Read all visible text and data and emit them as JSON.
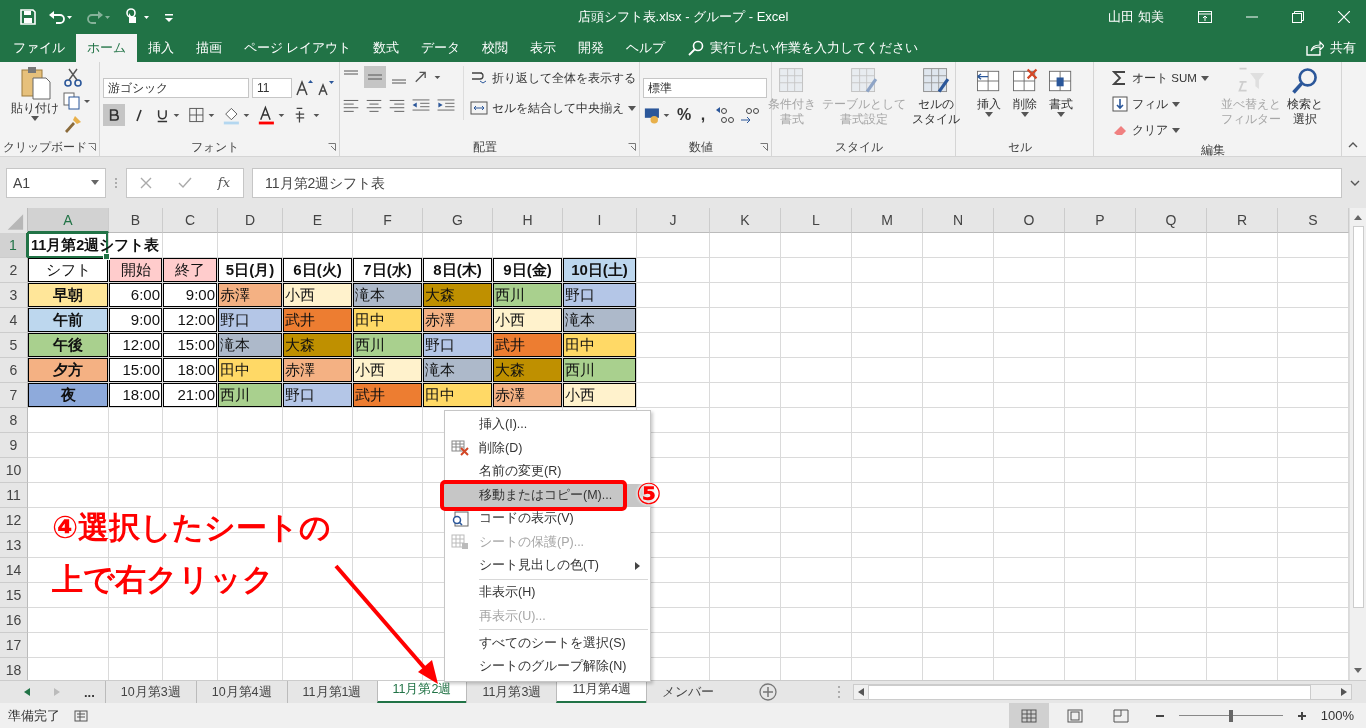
{
  "title_bar": {
    "title": "店頭シフト表.xlsx  -  グループ  -  Excel",
    "user": "山田 知美"
  },
  "ribbon": {
    "tabs": [
      {
        "label": "ファイル",
        "selected": false
      },
      {
        "label": "ホーム",
        "selected": true
      },
      {
        "label": "挿入",
        "selected": false
      },
      {
        "label": "描画",
        "selected": false
      },
      {
        "label": "ページ レイアウト",
        "selected": false
      },
      {
        "label": "数式",
        "selected": false
      },
      {
        "label": "データ",
        "selected": false
      },
      {
        "label": "校閲",
        "selected": false
      },
      {
        "label": "表示",
        "selected": false
      },
      {
        "label": "開発",
        "selected": false
      },
      {
        "label": "ヘルプ",
        "selected": false
      }
    ],
    "tell_me": "実行したい作業を入力してください",
    "share": "共有",
    "groups": [
      {
        "label": "クリップボード",
        "paste": "貼り付け"
      },
      {
        "label": "フォント",
        "font_name": "游ゴシック",
        "font_size": "11",
        "bold": true
      },
      {
        "label": "配置",
        "middle_align": true,
        "wrap_text": "折り返して全体を表示する",
        "merge": "セルを結合して中央揃え"
      },
      {
        "label": "数値",
        "format": "標準",
        "percent": "%",
        "comma": ","
      },
      {
        "label": "スタイル",
        "buttons": [
          {
            "lines": [
              "条件付き",
              "書式"
            ],
            "disabled": true
          },
          {
            "lines": [
              "テーブルとして",
              "書式設定"
            ],
            "disabled": true
          },
          {
            "lines": [
              "セルの",
              "スタイル"
            ],
            "disabled": false
          }
        ]
      },
      {
        "label": "セル",
        "buttons": [
          {
            "lines": [
              "挿入"
            ],
            "disabled": false
          },
          {
            "lines": [
              "削除"
            ],
            "disabled": false
          },
          {
            "lines": [
              "書式"
            ],
            "disabled": false
          }
        ]
      },
      {
        "label": "編集",
        "small": [
          "オート SUM",
          "フィル",
          "クリア"
        ],
        "buttons": [
          {
            "lines": [
              "並べ替えと",
              "フィルター"
            ],
            "disabled": true
          },
          {
            "lines": [
              "検索と",
              "選択"
            ],
            "disabled": false
          }
        ]
      }
    ]
  },
  "formula_bar": {
    "name_box": "A1",
    "function_label": "fx",
    "formula": "11月第2週シフト表"
  },
  "sheet": {
    "columns": [
      {
        "label": "A",
        "selected": true
      },
      {
        "label": "B",
        "selected": false
      },
      {
        "label": "C",
        "selected": false
      },
      {
        "label": "D",
        "selected": false
      },
      {
        "label": "E",
        "selected": false
      },
      {
        "label": "F",
        "selected": false
      },
      {
        "label": "G",
        "selected": false
      },
      {
        "label": "H",
        "selected": false
      },
      {
        "label": "I",
        "selected": false
      },
      {
        "label": "J",
        "selected": false
      },
      {
        "label": "K",
        "selected": false
      },
      {
        "label": "L",
        "selected": false
      },
      {
        "label": "M",
        "selected": false
      },
      {
        "label": "N",
        "selected": false
      },
      {
        "label": "O",
        "selected": false
      },
      {
        "label": "P",
        "selected": false
      },
      {
        "label": "Q",
        "selected": false
      },
      {
        "label": "R",
        "selected": false
      },
      {
        "label": "S",
        "selected": false
      }
    ],
    "rows": [
      {
        "label": "1",
        "selected": true,
        "cells": [
          {
            "text": "11月第2週シフト表",
            "kind": "title",
            "bold": true,
            "selected": true
          }
        ]
      },
      {
        "label": "2",
        "selected": false,
        "cells": [
          {
            "text": "シフト",
            "kind": "label",
            "bold": false
          },
          {
            "text": "開始",
            "kind": "label",
            "bold": false,
            "color": "#ffcccc"
          },
          {
            "text": "終了",
            "kind": "label",
            "bold": false,
            "color": "#ffcccc"
          },
          {
            "text": "5日(月)",
            "kind": "label",
            "bold": true
          },
          {
            "text": "6日(火)",
            "kind": "label",
            "bold": true
          },
          {
            "text": "7日(水)",
            "kind": "label",
            "bold": true
          },
          {
            "text": "8日(木)",
            "kind": "label",
            "bold": true
          },
          {
            "text": "9日(金)",
            "kind": "label",
            "bold": true
          },
          {
            "text": "10日(土)",
            "kind": "label",
            "bold": true,
            "color": "#bdd7ee"
          }
        ]
      },
      {
        "label": "3",
        "selected": false,
        "cells": [
          {
            "text": "早朝",
            "kind": "label",
            "bold": true,
            "color": "#ffe699"
          },
          {
            "text": "6:00",
            "kind": "time",
            "bold": false
          },
          {
            "text": "9:00",
            "kind": "time",
            "bold": false
          },
          {
            "text": "赤澤",
            "kind": "name",
            "bold": false,
            "color": "#f4b183"
          },
          {
            "text": "小西",
            "kind": "name",
            "bold": false,
            "color": "#fff2cc"
          },
          {
            "text": "滝本",
            "kind": "name",
            "bold": false,
            "color": "#adb9ca"
          },
          {
            "text": "大森",
            "kind": "name",
            "bold": false,
            "color": "#bf9000"
          },
          {
            "text": "西川",
            "kind": "name",
            "bold": false,
            "color": "#a9d08e"
          },
          {
            "text": "野口",
            "kind": "name",
            "bold": false,
            "color": "#b4c6e7"
          }
        ]
      },
      {
        "label": "4",
        "selected": false,
        "cells": [
          {
            "text": "午前",
            "kind": "label",
            "bold": true,
            "color": "#bdd7ee"
          },
          {
            "text": "9:00",
            "kind": "time",
            "bold": false
          },
          {
            "text": "12:00",
            "kind": "time",
            "bold": false
          },
          {
            "text": "野口",
            "kind": "name",
            "bold": false,
            "color": "#b4c6e7"
          },
          {
            "text": "武井",
            "kind": "name",
            "bold": false,
            "color": "#ed7d31"
          },
          {
            "text": "田中",
            "kind": "name",
            "bold": false,
            "color": "#ffd966"
          },
          {
            "text": "赤澤",
            "kind": "name",
            "bold": false,
            "color": "#f4b183"
          },
          {
            "text": "小西",
            "kind": "name",
            "bold": false,
            "color": "#fff2cc"
          },
          {
            "text": "滝本",
            "kind": "name",
            "bold": false,
            "color": "#adb9ca"
          }
        ]
      },
      {
        "label": "5",
        "selected": false,
        "cells": [
          {
            "text": "午後",
            "kind": "label",
            "bold": true,
            "color": "#a9d08e"
          },
          {
            "text": "12:00",
            "kind": "time",
            "bold": false
          },
          {
            "text": "15:00",
            "kind": "time",
            "bold": false
          },
          {
            "text": "滝本",
            "kind": "name",
            "bold": false,
            "color": "#adb9ca"
          },
          {
            "text": "大森",
            "kind": "name",
            "bold": false,
            "color": "#bf9000"
          },
          {
            "text": "西川",
            "kind": "name",
            "bold": false,
            "color": "#a9d08e"
          },
          {
            "text": "野口",
            "kind": "name",
            "bold": false,
            "color": "#b4c6e7"
          },
          {
            "text": "武井",
            "kind": "name",
            "bold": false,
            "color": "#ed7d31"
          },
          {
            "text": "田中",
            "kind": "name",
            "bold": false,
            "color": "#ffd966"
          }
        ]
      },
      {
        "label": "6",
        "selected": false,
        "cells": [
          {
            "text": "夕方",
            "kind": "label",
            "bold": true,
            "color": "#f4b183"
          },
          {
            "text": "15:00",
            "kind": "time",
            "bold": false
          },
          {
            "text": "18:00",
            "kind": "time",
            "bold": false
          },
          {
            "text": "田中",
            "kind": "name",
            "bold": false,
            "color": "#ffd966"
          },
          {
            "text": "赤澤",
            "kind": "name",
            "bold": false,
            "color": "#f4b183"
          },
          {
            "text": "小西",
            "kind": "name",
            "bold": false,
            "color": "#fff2cc"
          },
          {
            "text": "滝本",
            "kind": "name",
            "bold": false,
            "color": "#adb9ca"
          },
          {
            "text": "大森",
            "kind": "name",
            "bold": false,
            "color": "#bf9000"
          },
          {
            "text": "西川",
            "kind": "name",
            "bold": false,
            "color": "#a9d08e"
          }
        ]
      },
      {
        "label": "7",
        "selected": false,
        "cells": [
          {
            "text": "夜",
            "kind": "label",
            "bold": true,
            "color": "#8eaadb"
          },
          {
            "text": "18:00",
            "kind": "time",
            "bold": false
          },
          {
            "text": "21:00",
            "kind": "time",
            "bold": false
          },
          {
            "text": "西川",
            "kind": "name",
            "bold": false,
            "color": "#a9d08e"
          },
          {
            "text": "野口",
            "kind": "name",
            "bold": false,
            "color": "#b4c6e7"
          },
          {
            "text": "武井",
            "kind": "name",
            "bold": false,
            "color": "#ed7d31"
          },
          {
            "text": "田中",
            "kind": "name",
            "bold": false,
            "color": "#ffd966"
          },
          {
            "text": "赤澤",
            "kind": "name",
            "bold": false,
            "color": "#f4b183"
          },
          {
            "text": "小西",
            "kind": "name",
            "bold": false,
            "color": "#fff2cc"
          }
        ]
      },
      {
        "label": "8",
        "selected": false
      },
      {
        "label": "9",
        "selected": false
      },
      {
        "label": "10",
        "selected": false
      },
      {
        "label": "11",
        "selected": false
      },
      {
        "label": "12",
        "selected": false
      },
      {
        "label": "13",
        "selected": false
      },
      {
        "label": "14",
        "selected": false
      },
      {
        "label": "15",
        "selected": false
      },
      {
        "label": "16",
        "selected": false
      },
      {
        "label": "17",
        "selected": false
      },
      {
        "label": "18",
        "selected": false
      }
    ]
  },
  "context_menu": [
    {
      "label": "挿入(I)...",
      "disabled": false,
      "selected": false,
      "submenu": false,
      "separator_before": false
    },
    {
      "label": "削除(D)",
      "disabled": false,
      "selected": false,
      "submenu": false,
      "separator_before": false
    },
    {
      "label": "名前の変更(R)",
      "disabled": false,
      "selected": false,
      "submenu": false,
      "separator_before": false
    },
    {
      "label": "移動またはコピー(M)...",
      "disabled": false,
      "selected": true,
      "submenu": false,
      "separator_before": false
    },
    {
      "label": "コードの表示(V)",
      "disabled": false,
      "selected": false,
      "submenu": false,
      "separator_before": false
    },
    {
      "label": "シートの保護(P)...",
      "disabled": true,
      "selected": false,
      "submenu": false,
      "separator_before": false
    },
    {
      "label": "シート見出しの色(T)",
      "disabled": false,
      "selected": false,
      "submenu": true,
      "separator_before": false
    },
    {
      "label": "非表示(H)",
      "disabled": false,
      "selected": false,
      "submenu": false,
      "separator_before": true
    },
    {
      "label": "再表示(U)...",
      "disabled": true,
      "selected": false,
      "submenu": false,
      "separator_before": false
    },
    {
      "label": "すべてのシートを選択(S)",
      "disabled": false,
      "selected": false,
      "submenu": false,
      "separator_before": true
    },
    {
      "label": "シートのグループ解除(N)",
      "disabled": false,
      "selected": false,
      "submenu": false,
      "separator_before": false
    }
  ],
  "annotations": {
    "instruction_lines": [
      "④選択したシートの",
      "上で右クリック"
    ],
    "step_number": "⑤"
  },
  "sheet_tabs": {
    "overflow": "...",
    "tabs": [
      {
        "label": "10月第3週",
        "selected": false,
        "grouped": false
      },
      {
        "label": "10月第4週",
        "selected": false,
        "grouped": false
      },
      {
        "label": "11月第1週",
        "selected": false,
        "grouped": false
      },
      {
        "label": "11月第2週",
        "selected": true,
        "grouped": true
      },
      {
        "label": "11月第3週",
        "selected": false,
        "grouped": false
      },
      {
        "label": "11月第4週",
        "selected": false,
        "grouped": true
      },
      {
        "label": "メンバー",
        "selected": false,
        "grouped": false
      }
    ]
  },
  "status_bar": {
    "status": "準備完了",
    "zoom": "100%",
    "zoom_slider": {
      "level": 0.5
    }
  }
}
